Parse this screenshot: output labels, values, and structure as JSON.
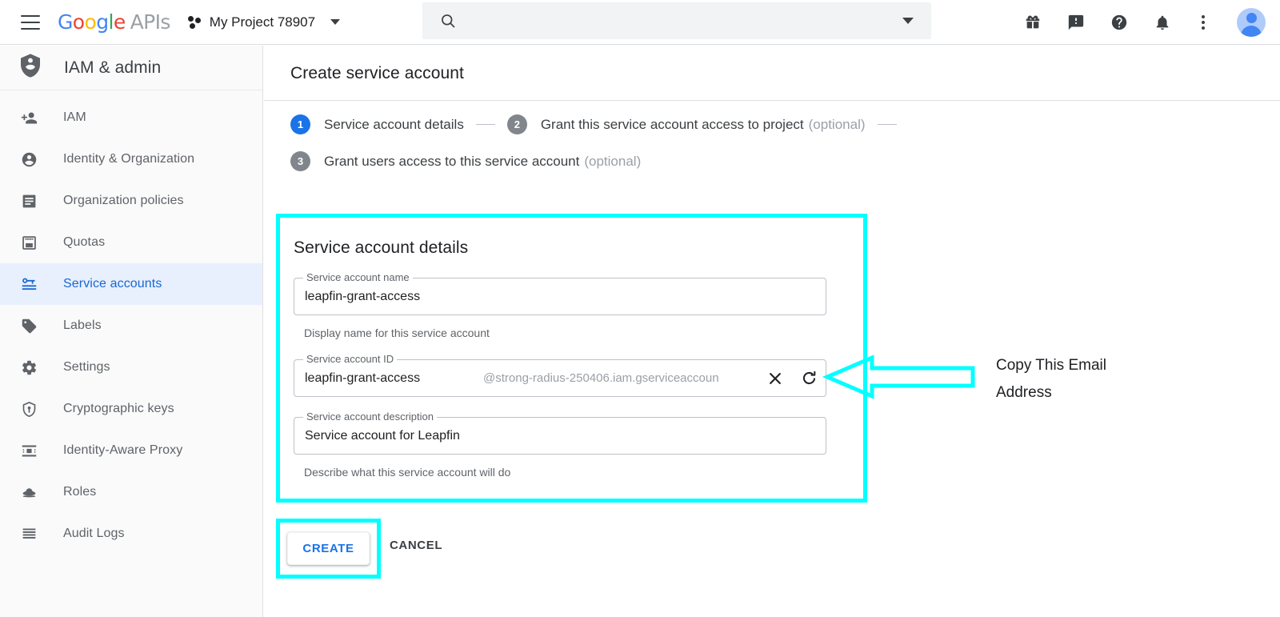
{
  "topbar": {
    "menu_icon": "hamburger-menu-icon",
    "logo": {
      "g1": "G",
      "o1": "o",
      "o2": "o",
      "g2": "g",
      "l": "l",
      "e": "e",
      "suffix": "APIs"
    },
    "project_name": "My Project 78907",
    "project_icon": "cloud-project-icon",
    "search": {
      "value": "",
      "placeholder": "",
      "icon": "search-icon",
      "dropdown_icon": "chevron-down-icon"
    },
    "icons": [
      {
        "name": "gift-icon",
        "label": "Offers"
      },
      {
        "name": "feedback-icon",
        "label": "Send feedback"
      },
      {
        "name": "help-icon",
        "label": "Help"
      },
      {
        "name": "notifications-bell-icon",
        "label": "Notifications"
      },
      {
        "name": "more-options-kebab-icon",
        "label": "More options"
      }
    ],
    "avatar_label": "Account"
  },
  "sidebar": {
    "title": "IAM & admin",
    "title_icon": "iam-shield-person-icon",
    "items": [
      {
        "label": "IAM",
        "icon": "person-add-icon",
        "active": false
      },
      {
        "label": "Identity & Organization",
        "icon": "account-circle-icon",
        "active": false
      },
      {
        "label": "Organization policies",
        "icon": "policy-document-icon",
        "active": false
      },
      {
        "label": "Quotas",
        "icon": "quotas-icon",
        "active": false
      },
      {
        "label": "Service accounts",
        "icon": "service-account-key-icon",
        "active": true
      },
      {
        "label": "Labels",
        "icon": "label-tag-icon",
        "active": false
      },
      {
        "label": "Settings",
        "icon": "gear-icon",
        "active": false
      },
      {
        "label": "Cryptographic keys",
        "icon": "shield-key-icon",
        "active": false
      },
      {
        "label": "Identity-Aware Proxy",
        "icon": "identity-aware-proxy-icon",
        "active": false
      },
      {
        "label": "Roles",
        "icon": "roles-hat-icon",
        "active": false
      },
      {
        "label": "Audit Logs",
        "icon": "audit-logs-icon",
        "active": false
      }
    ]
  },
  "main": {
    "page_title": "Create service account",
    "stepper": [
      {
        "number": "1",
        "label": "Service account details",
        "optional": "",
        "state": "on"
      },
      {
        "number": "2",
        "label": "Grant this service account access to project",
        "optional": "(optional)",
        "state": "off"
      },
      {
        "number": "3",
        "label": "Grant users access to this service account",
        "optional": "(optional)",
        "state": "off"
      }
    ],
    "card": {
      "title": "Service account details",
      "fields": [
        {
          "label": "Service account name",
          "value": "leapfin-grant-access",
          "suffix": "",
          "help": "Display name for this service account"
        },
        {
          "label": "Service account ID",
          "value": "leapfin-grant-access",
          "suffix": "@strong-radius-250406.iam.gserviceaccoun",
          "help": "",
          "clear_icon": "close-x-icon",
          "refresh_icon": "refresh-icon"
        },
        {
          "label": "Service account description",
          "value": "Service account for Leapfin",
          "suffix": "",
          "help": "Describe what this service account will do"
        }
      ]
    },
    "buttons": {
      "create": "CREATE",
      "cancel": "CANCEL"
    }
  },
  "annotation": {
    "text_line1": "Copy This Email",
    "text_line2": "Address",
    "arrow_icon": "left-pointing-arrow-annotation",
    "color": "#00ffff"
  },
  "colors": {
    "accent_blue": "#1a73e8",
    "active_nav_bg": "#e8f0fe",
    "active_nav_text": "#1967d2",
    "annotation_cyan": "#00ffff",
    "sidebar_bg": "#fafafa",
    "text_primary": "#202124",
    "text_secondary": "#5f6368"
  }
}
